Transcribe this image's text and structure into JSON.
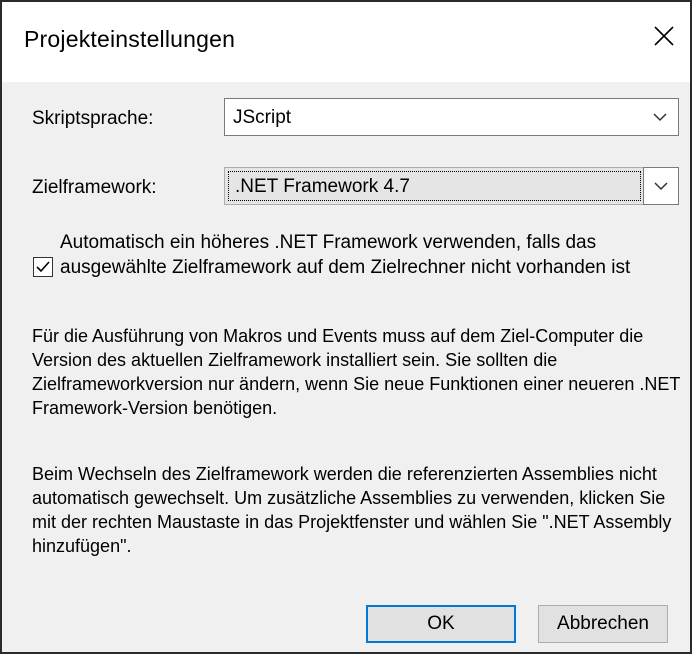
{
  "dialog": {
    "title": "Projekteinstellungen",
    "close_icon": "close-icon"
  },
  "script_language": {
    "label": "Skriptsprache:",
    "value": "JScript"
  },
  "target_framework": {
    "label": "Zielframework:",
    "value": ".NET Framework 4.7"
  },
  "auto_upgrade": {
    "checked": true,
    "text": "Automatisch ein höheres .NET Framework verwenden, falls das ausgewählte Zielframework auf dem Zielrechner nicht vorhanden ist"
  },
  "info": {
    "paragraph1": "Für die Ausführung von Makros und Events muss auf dem Ziel-Computer die Version des aktuellen Zielframework installiert sein. Sie sollten die Zielframeworkversion nur ändern, wenn Sie neue Funktionen einer neueren .NET Framework-Version benötigen.",
    "paragraph2": "Beim Wechseln des Zielframework werden die referenzierten Assemblies nicht automatisch gewechselt. Um zusätzliche Assemblies zu verwenden, klicken Sie mit der rechten Maustaste in das Projektfenster und wählen Sie \".NET Assembly hinzufügen\"."
  },
  "buttons": {
    "ok": "OK",
    "cancel": "Abbrechen"
  },
  "colors": {
    "accent": "#0078d7",
    "dialog_bg": "#f0f0f0"
  }
}
